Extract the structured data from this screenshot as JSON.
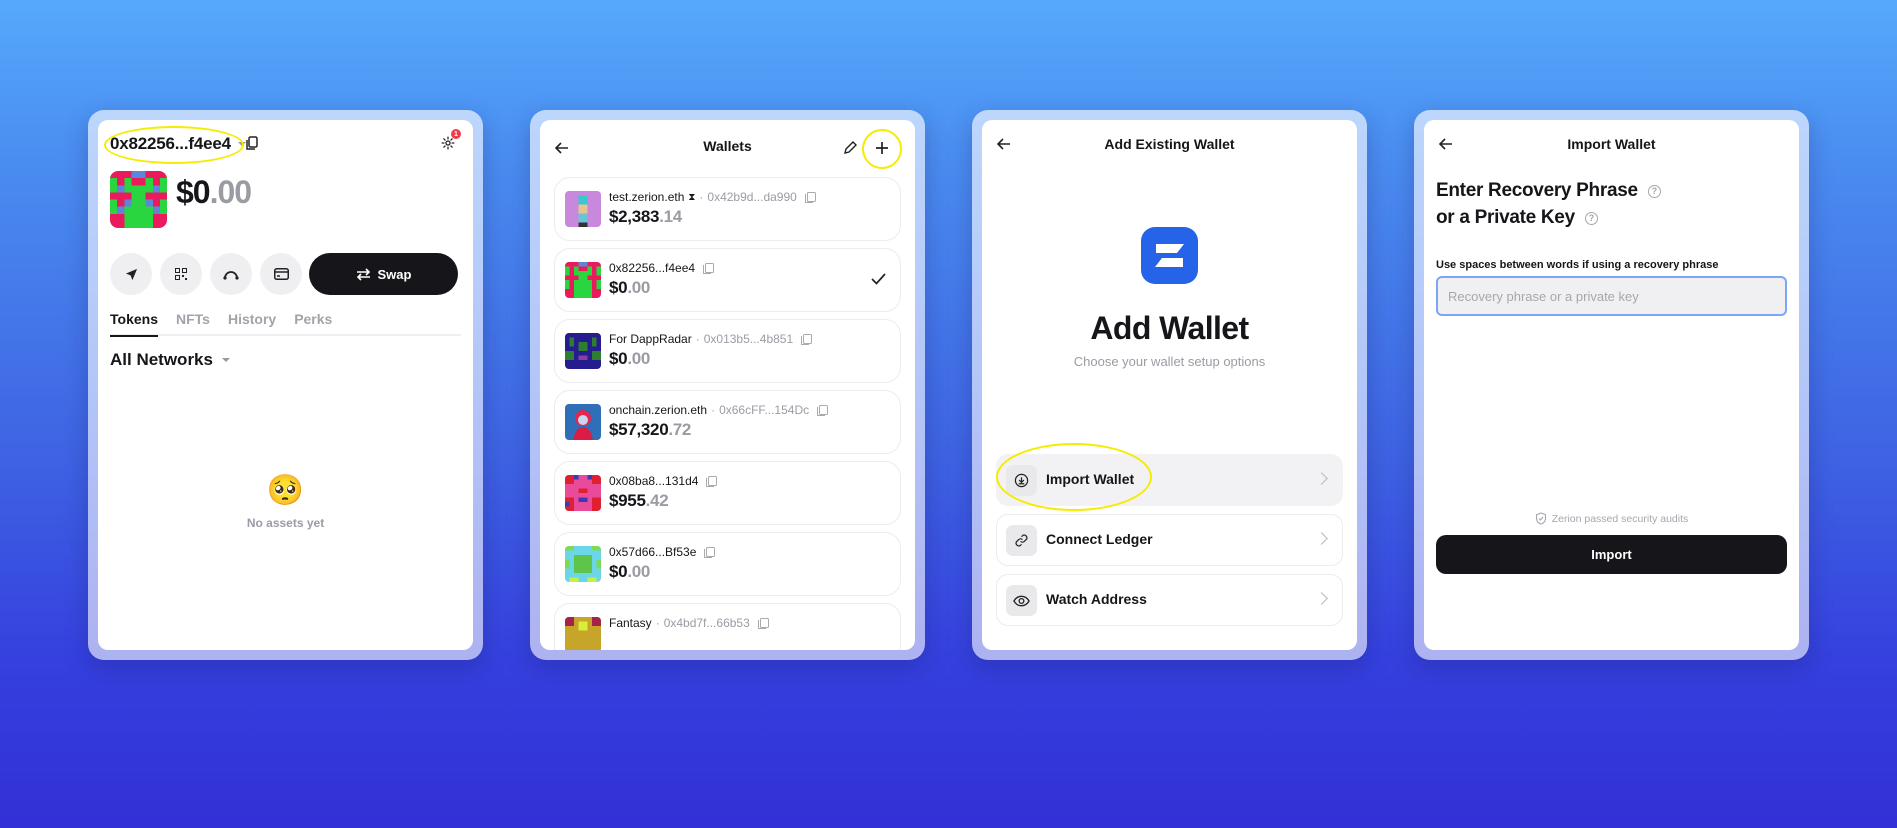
{
  "panel_wallet": {
    "address": "0x82256...f4ee4",
    "balance_whole": "$0",
    "balance_cents": ".00",
    "settings_badge_count": "1",
    "swap_label": "Swap",
    "action_icons": [
      "send-icon",
      "qr-code-icon",
      "bridge-icon",
      "card-icon"
    ],
    "tabs": [
      {
        "label": "Tokens",
        "active": true
      },
      {
        "label": "NFTs",
        "active": false
      },
      {
        "label": "History",
        "active": false
      },
      {
        "label": "Perks",
        "active": false
      }
    ],
    "network_selector": "All Networks",
    "empty_emoji": "🥺",
    "empty_text": "No assets yet"
  },
  "panel_wallets": {
    "title": "Wallets",
    "wallets": [
      {
        "name": "test.zerion.eth",
        "badge": "⧗",
        "address": "0x42b9d...da990",
        "balance_whole": "$2,383",
        "balance_cents": ".14",
        "selected": false
      },
      {
        "name": "0x82256...f4ee4",
        "badge": "",
        "address": "",
        "balance_whole": "$0",
        "balance_cents": ".00",
        "selected": true
      },
      {
        "name": "For DappRadar",
        "badge": "",
        "address": "0x013b5...4b851",
        "balance_whole": "$0",
        "balance_cents": ".00",
        "selected": false
      },
      {
        "name": "onchain.zerion.eth",
        "badge": "",
        "address": "0x66cFF...154Dc",
        "balance_whole": "$57,320",
        "balance_cents": ".72",
        "selected": false
      },
      {
        "name": "0x08ba8...131d4",
        "badge": "",
        "address": "",
        "balance_whole": "$955",
        "balance_cents": ".42",
        "selected": false
      },
      {
        "name": "0x57d66...Bf53e",
        "badge": "",
        "address": "",
        "balance_whole": "$0",
        "balance_cents": ".00",
        "selected": false
      },
      {
        "name": "Fantasy",
        "badge": "",
        "address": "0x4bd7f...66b53",
        "balance_whole": "",
        "balance_cents": "",
        "selected": false
      }
    ]
  },
  "panel_add": {
    "title": "Add Existing Wallet",
    "heading": "Add Wallet",
    "subtitle": "Choose your wallet setup options",
    "options": [
      {
        "label": "Import Wallet",
        "icon": "download-icon",
        "selected": true
      },
      {
        "label": "Connect Ledger",
        "icon": "link-icon",
        "selected": false
      },
      {
        "label": "Watch Address",
        "icon": "eye-icon",
        "selected": false
      }
    ]
  },
  "panel_import": {
    "title": "Import Wallet",
    "heading_line1": "Enter Recovery Phrase",
    "heading_line2": "or a Private Key",
    "hint": "Use spaces between words if using a recovery phrase",
    "input_placeholder": "Recovery phrase or a private key",
    "input_value": "",
    "audit_text": "Zerion passed security audits",
    "import_label": "Import"
  },
  "colors": {
    "accent_blue": "#2563e8",
    "highlight": "#f5ec00",
    "dark": "#16161a",
    "muted": "#9a9ca4"
  }
}
